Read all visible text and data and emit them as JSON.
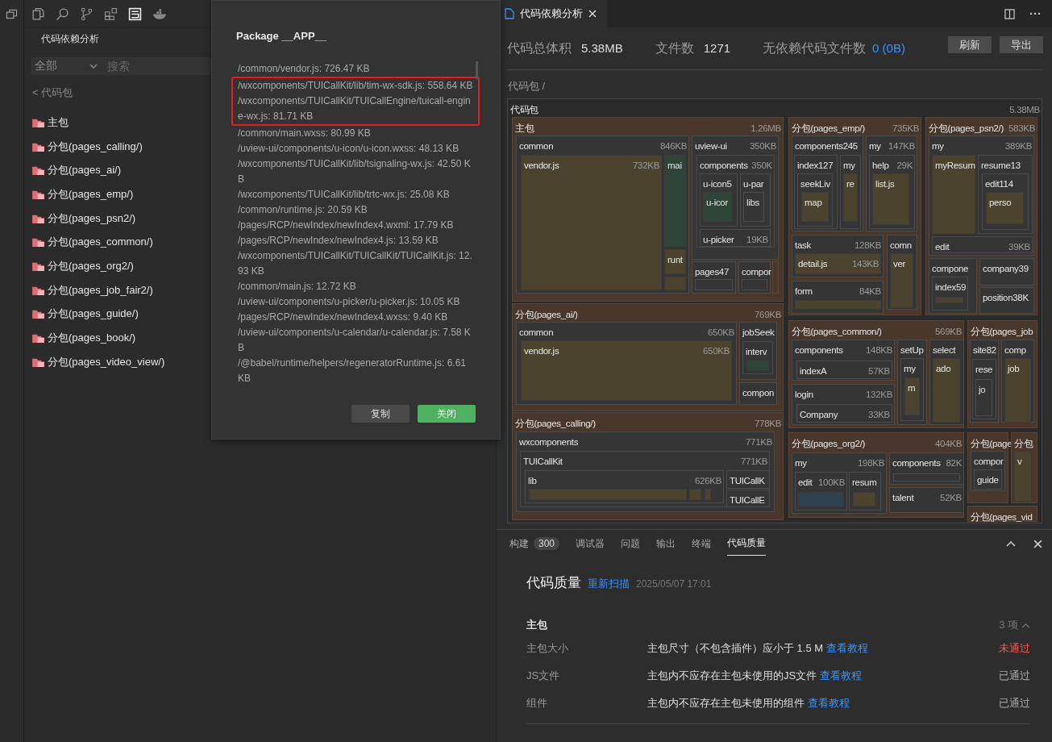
{
  "sidebar": {
    "title": "代码依赖分析",
    "filter": {
      "value": "全部"
    },
    "search": {
      "placeholder": "搜索"
    },
    "back_link": "< 代码包",
    "packages": [
      {
        "label": "主包"
      },
      {
        "label": "分包(pages_calling/)"
      },
      {
        "label": "分包(pages_ai/)"
      },
      {
        "label": "分包(pages_emp/)"
      },
      {
        "label": "分包(pages_psn2/)"
      },
      {
        "label": "分包(pages_common/)"
      },
      {
        "label": "分包(pages_org2/)"
      },
      {
        "label": "分包(pages_job_fair2/)"
      },
      {
        "label": "分包(pages_guide/)"
      },
      {
        "label": "分包(pages_book/)"
      },
      {
        "label": "分包(pages_video_view/)"
      }
    ]
  },
  "dialog": {
    "title": "Package __APP__",
    "files": [
      {
        "text": "/common/vendor.js: 726.47 KB",
        "highlighted": false
      },
      {
        "text": "/wxcomponents/TUICallKit/lib/tim-wx-sdk.js: 558.64 KB",
        "highlighted": true
      },
      {
        "text": "/wxcomponents/TUICallKit/TUICallEngine/tuicall-engine-wx.js: 81.71 KB",
        "highlighted": true
      },
      {
        "text": "/common/main.wxss: 80.99 KB",
        "highlighted": false
      },
      {
        "text": "/uview-ui/components/u-icon/u-icon.wxss: 48.13 KB",
        "highlighted": false
      },
      {
        "text": "/wxcomponents/TUICallKit/lib/tsignaling-wx.js: 42.50 KB",
        "highlighted": false
      },
      {
        "text": "/wxcomponents/TUICallKit/lib/trtc-wx.js: 25.08 KB",
        "highlighted": false
      },
      {
        "text": "/common/runtime.js: 20.59 KB",
        "highlighted": false
      },
      {
        "text": "/pages/RCP/newIndex/newIndex4.wxml: 17.79 KB",
        "highlighted": false
      },
      {
        "text": "/pages/RCP/newIndex/newIndex4.js: 13.59 KB",
        "highlighted": false
      },
      {
        "text": "/wxcomponents/TUICallKit/TUICallKit/TUICallKit.js: 12.93 KB",
        "highlighted": false
      },
      {
        "text": "/common/main.js: 12.72 KB",
        "highlighted": false
      },
      {
        "text": "/uview-ui/components/u-picker/u-picker.js: 10.05 KB",
        "highlighted": false
      },
      {
        "text": "/pages/RCP/newIndex/newIndex4.wxss: 9.40 KB",
        "highlighted": false
      },
      {
        "text": "/uview-ui/components/u-calendar/u-calendar.js: 7.58 KB",
        "highlighted": false
      },
      {
        "text": "/@babel/runtime/helpers/regeneratorRuntime.js: 6.61 KB",
        "highlighted": false
      }
    ],
    "buttons": [
      {
        "label": "复制",
        "primary": false
      },
      {
        "label": "关闭",
        "primary": true
      }
    ]
  },
  "editor_tab": {
    "label": "代码依赖分析"
  },
  "stats": [
    {
      "label": "代码总体积",
      "value": "5.38MB",
      "kind": "plain"
    },
    {
      "label": "文件数",
      "value": "1271",
      "kind": "plain"
    },
    {
      "label": "无依赖代码文件数",
      "value": "0 (0B)",
      "kind": "link"
    }
  ],
  "actions": [
    "刷新",
    "导出"
  ],
  "breadcrumb": "代码包 /",
  "treemap": {
    "label": "代码包",
    "size": "5.38MB",
    "kind": "root",
    "children": [
      {
        "label": "主包",
        "size": "1.26MB",
        "kind": "package",
        "children": [
          {
            "label": "common",
            "size": "846KB",
            "kind": "folder",
            "children": [
              {
                "label": "vendor.js",
                "size": "732KB",
                "kind": "file",
                "color": "#4b432e"
              },
              {
                "label": "mai",
                "kind": "file",
                "color": "#2c4536"
              },
              {
                "label": "runt",
                "kind": "file",
                "color": "#4b432e"
              },
              {
                "kind": "file",
                "color": "#4b432e"
              }
            ]
          },
          {
            "label": "uview-ui",
            "size": "350KB",
            "kind": "folder",
            "children": [
              {
                "label": "components",
                "size": "350K",
                "kind": "folder",
                "children": [
                  {
                    "label": "u-icon5",
                    "kind": "folder",
                    "children": [
                      {
                        "label": "u-icor",
                        "kind": "file",
                        "color": "#2c4536"
                      }
                    ]
                  },
                  {
                    "label": "u-par",
                    "kind": "folder",
                    "children": [
                      {
                        "label": "libs",
                        "kind": "folder"
                      }
                    ]
                  },
                  {
                    "label": "u-picker",
                    "size": "19KB",
                    "kind": "folder"
                  }
                ]
              }
            ]
          },
          {
            "label": "pages47",
            "kind": "folder",
            "children": [
              {
                "kind": "folder"
              }
            ]
          },
          {
            "label": "compor",
            "kind": "folder",
            "children": [
              {
                "kind": "folder"
              }
            ]
          },
          {
            "kind": "package"
          }
        ]
      },
      {
        "label": "分包(pages_emp/)",
        "size": "735KB",
        "kind": "package",
        "children": [
          {
            "label": "components245",
            "kind": "folder",
            "children": [
              {
                "label": "index127",
                "kind": "folder",
                "children": [
                  {
                    "label": "seekLiv",
                    "kind": "folder",
                    "children": [
                      {
                        "label": "map",
                        "kind": "file",
                        "color": "#4b432e"
                      }
                    ]
                  }
                ]
              },
              {
                "label": "my",
                "kind": "folder",
                "children": [
                  {
                    "label": "re",
                    "kind": "file",
                    "color": "#4b432e"
                  }
                ]
              }
            ]
          },
          {
            "label": "my",
            "size": "147KB",
            "kind": "folder",
            "children": [
              {
                "label": "help",
                "size": "29K",
                "kind": "folder",
                "children": [
                  {
                    "label": "list.js",
                    "kind": "file",
                    "color": "#4b432e"
                  }
                ]
              }
            ]
          },
          {
            "label": "task",
            "size": "128KB",
            "kind": "folder",
            "children": [
              {
                "label": "detail.js",
                "size": "143KB",
                "kind": "file",
                "color": "#4b432e"
              }
            ]
          },
          {
            "label": "comn",
            "kind": "folder",
            "children": [
              {
                "label": "ver",
                "kind": "file",
                "color": "#4b432e"
              }
            ]
          },
          {
            "label": "form",
            "size": "84KB",
            "kind": "folder",
            "children": [
              {
                "kind": "file",
                "color": "#4b432e"
              }
            ]
          }
        ]
      },
      {
        "label": "分包(pages_psn2/)",
        "size": "583KB",
        "kind": "package",
        "children": [
          {
            "label": "my",
            "size": "389KB",
            "kind": "folder",
            "children": [
              {
                "label": "myResum",
                "kind": "file",
                "color": "#4b432e"
              },
              {
                "label": "resume13",
                "kind": "folder",
                "children": [
                  {
                    "label": "edit114",
                    "kind": "folder",
                    "children": [
                      {
                        "label": "perso",
                        "kind": "file",
                        "color": "#4b432e"
                      }
                    ]
                  }
                ]
              },
              {
                "label": "edit",
                "size": "39KB",
                "kind": "folder"
              }
            ]
          },
          {
            "label": "compone",
            "kind": "folder",
            "children": [
              {
                "label": "index59",
                "kind": "folder",
                "children": [
                  {
                    "kind": "file",
                    "color": "#4b432e"
                  }
                ]
              }
            ]
          },
          {
            "label": "company39",
            "kind": "folder"
          },
          {
            "label": "position38K",
            "kind": "folder"
          }
        ]
      },
      {
        "label": "分包(pages_ai/)",
        "size": "769KB",
        "kind": "package",
        "children": [
          {
            "label": "common",
            "size": "650KB",
            "kind": "folder",
            "children": [
              {
                "label": "vendor.js",
                "size": "650KB",
                "kind": "file",
                "color": "#4b432e"
              }
            ]
          },
          {
            "label": "jobSeek",
            "kind": "folder",
            "children": [
              {
                "label": "interv",
                "kind": "folder",
                "children": [
                  {
                    "kind": "file",
                    "color": "#2c4536"
                  }
                ]
              }
            ]
          },
          {
            "label": "compon",
            "kind": "folder"
          }
        ]
      },
      {
        "label": "分包(pages_common/)",
        "size": "569KB",
        "kind": "package",
        "children": [
          {
            "label": "components",
            "size": "148KB",
            "kind": "folder",
            "children": [
              {
                "label": "indexA",
                "size": "57KB",
                "kind": "folder"
              }
            ]
          },
          {
            "label": "login",
            "size": "132KB",
            "kind": "folder",
            "children": [
              {
                "label": "Company",
                "size": "33KB",
                "kind": "folder"
              }
            ]
          },
          {
            "label": "setUp",
            "kind": "folder",
            "children": [
              {
                "label": "my",
                "kind": "folder",
                "children": [
                  {
                    "label": "m",
                    "kind": "file",
                    "color": "#4b432e"
                  }
                ]
              }
            ]
          },
          {
            "label": "select",
            "kind": "folder",
            "children": [
              {
                "label": "ado",
                "kind": "file",
                "color": "#4b432e"
              }
            ]
          }
        ]
      },
      {
        "label": "分包(pages_job",
        "kind": "package",
        "children": [
          {
            "label": "site82",
            "kind": "folder",
            "children": [
              {
                "label": "rese",
                "kind": "folder",
                "children": [
                  {
                    "label": "jo",
                    "kind": "folder"
                  }
                ]
              }
            ]
          },
          {
            "label": "comp",
            "kind": "folder",
            "children": [
              {
                "label": "job",
                "kind": "file",
                "color": "#4b432e"
              }
            ]
          }
        ]
      },
      {
        "label": "分包(pages_calling/)",
        "size": "778KB",
        "kind": "package",
        "children": [
          {
            "label": "wxcomponents",
            "size": "771KB",
            "kind": "folder",
            "children": [
              {
                "label": "TUICallKit",
                "size": "771KB",
                "kind": "folder",
                "children": [
                  {
                    "label": "lib",
                    "size": "626KB",
                    "kind": "folder",
                    "children": [
                      {
                        "kind": "file",
                        "color": "#4b432e"
                      },
                      {
                        "kind": "file",
                        "color": "#4b432e"
                      },
                      {
                        "kind": "file",
                        "color": "#4b432e"
                      }
                    ]
                  },
                  {
                    "label": "TUICallK",
                    "kind": "folder"
                  },
                  {
                    "label": "TUICallE",
                    "kind": "folder"
                  }
                ]
              }
            ]
          }
        ]
      },
      {
        "label": "分包(pages_org2/)",
        "size": "404KB",
        "kind": "package",
        "children": [
          {
            "label": "my",
            "size": "198KB",
            "kind": "folder",
            "children": [
              {
                "label": "edit",
                "size": "100KB",
                "kind": "folder",
                "children": [
                  {
                    "kind": "file",
                    "color": "#2f4150"
                  }
                ]
              },
              {
                "label": "resum",
                "kind": "folder",
                "children": [
                  {
                    "kind": "file",
                    "color": "#4b432e"
                  }
                ]
              }
            ]
          },
          {
            "label": "components",
            "size": "82K",
            "kind": "folder",
            "children": [
              {
                "kind": "folder"
              }
            ]
          },
          {
            "label": "talent",
            "size": "52KB",
            "kind": "folder"
          }
        ]
      },
      {
        "label": "分包(page",
        "kind": "package",
        "children": [
          {
            "label": "compor",
            "kind": "folder",
            "children": [
              {
                "label": "guide",
                "kind": "folder"
              }
            ]
          }
        ]
      },
      {
        "label": "分包",
        "kind": "package",
        "children": [
          {
            "label": "v",
            "kind": "file",
            "color": "#4b432e"
          }
        ]
      },
      {
        "label": "分包(pages_vid",
        "kind": "package"
      }
    ]
  },
  "panel": {
    "tabs": [
      {
        "label": "构建",
        "badge": "300",
        "selected": false
      },
      {
        "label": "调试器",
        "selected": false
      },
      {
        "label": "问题",
        "selected": false
      },
      {
        "label": "输出",
        "selected": false
      },
      {
        "label": "终端",
        "selected": false
      },
      {
        "label": "代码质量",
        "selected": true
      }
    ],
    "title": "代码质量",
    "rescan": "重新扫描",
    "timestamp": "2025/05/07 17:01",
    "group": {
      "title": "主包",
      "count": "3 项",
      "expanded": true,
      "rows": [
        {
          "name": "主包大小",
          "description": "主包尺寸（不包含插件）应小于 1.5 M",
          "link": "查看教程",
          "status": "未通过",
          "passed": false
        },
        {
          "name": "JS文件",
          "description": "主包内不应存在主包未使用的JS文件",
          "link": "查看教程",
          "status": "已通过",
          "passed": true
        },
        {
          "name": "组件",
          "description": "主包内不应存在主包未使用的组件",
          "link": "查看教程",
          "status": "已通过",
          "passed": true
        }
      ]
    }
  }
}
